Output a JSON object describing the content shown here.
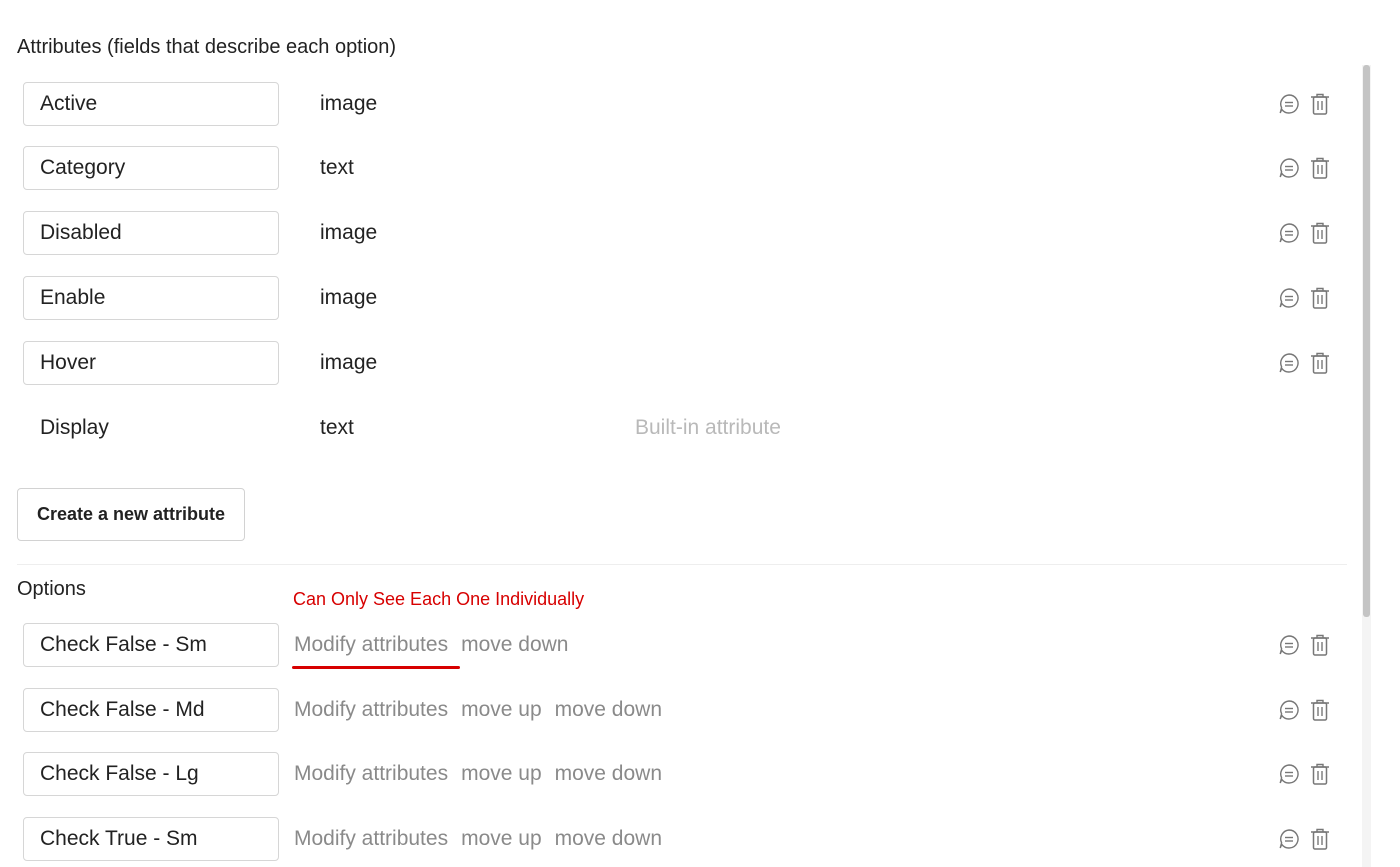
{
  "attributes_section": {
    "title": "Attributes (fields that describe each option)",
    "items": [
      {
        "name": "Active",
        "type": "image"
      },
      {
        "name": "Category",
        "type": "text"
      },
      {
        "name": "Disabled",
        "type": "image"
      },
      {
        "name": "Enable",
        "type": "image"
      },
      {
        "name": "Hover",
        "type": "image"
      }
    ],
    "builtin": {
      "name": "Display",
      "type": "text",
      "note": "Built-in attribute"
    },
    "create_button_label": "Create a new attribute"
  },
  "options_section": {
    "title": "Options",
    "annotation": "Can Only See Each One Individually",
    "items": [
      {
        "name": "Check False - Sm",
        "modify": "Modify attributes",
        "move_down": "move down"
      },
      {
        "name": "Check False - Md",
        "modify": "Modify attributes",
        "move_up": "move up",
        "move_down": "move down"
      },
      {
        "name": "Check False - Lg",
        "modify": "Modify attributes",
        "move_up": "move up",
        "move_down": "move down"
      },
      {
        "name": "Check True - Sm",
        "modify": "Modify attributes",
        "move_up": "move up",
        "move_down": "move down"
      }
    ]
  },
  "icons": {
    "comment": "comment-icon",
    "delete": "trash-icon"
  },
  "colors": {
    "annotation": "#d70000",
    "muted_text": "#8a8a8a",
    "builtin_text": "#b9b9b9"
  }
}
